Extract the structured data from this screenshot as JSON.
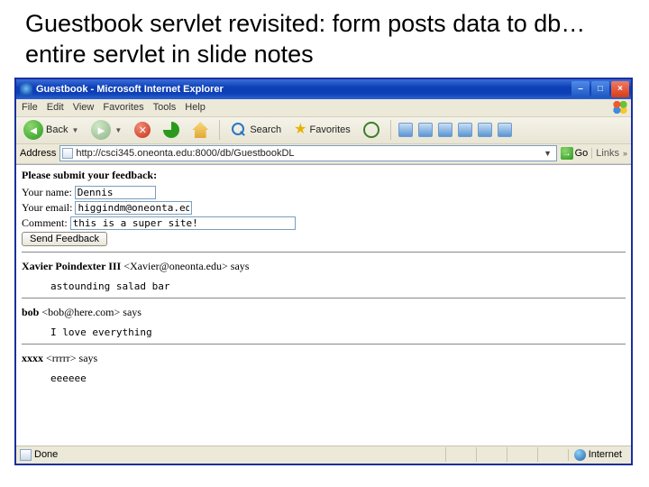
{
  "slide": {
    "title": "Guestbook servlet revisited: form posts data to db…entire servlet in slide notes"
  },
  "window": {
    "title": "Guestbook - Microsoft Internet Explorer"
  },
  "menu": {
    "file": "File",
    "edit": "Edit",
    "view": "View",
    "favorites": "Favorites",
    "tools": "Tools",
    "help": "Help"
  },
  "toolbar": {
    "back": "Back",
    "search": "Search",
    "favorites": "Favorites"
  },
  "address": {
    "label": "Address",
    "url": "http://csci345.oneonta.edu:8000/db/GuestbookDL",
    "go": "Go",
    "links": "Links"
  },
  "form": {
    "prompt": "Please submit your feedback:",
    "name_label": "Your name:",
    "name_value": "Dennis",
    "email_label": "Your email:",
    "email_value": "higgindm@oneonta.edu",
    "comment_label": "Comment:",
    "comment_value": "this is a super site!",
    "submit": "Send Feedback"
  },
  "entries": [
    {
      "name": "Xavier Poindexter III",
      "email": "Xavier@oneonta.edu",
      "says": "says",
      "body": "astounding salad bar"
    },
    {
      "name": "bob",
      "email": "bob@here.com",
      "says": "says",
      "body": "I love everything"
    },
    {
      "name": "xxxx",
      "email": "rrrrr",
      "says": "says",
      "body": "eeeeee"
    }
  ],
  "status": {
    "done": "Done",
    "zone": "Internet"
  }
}
